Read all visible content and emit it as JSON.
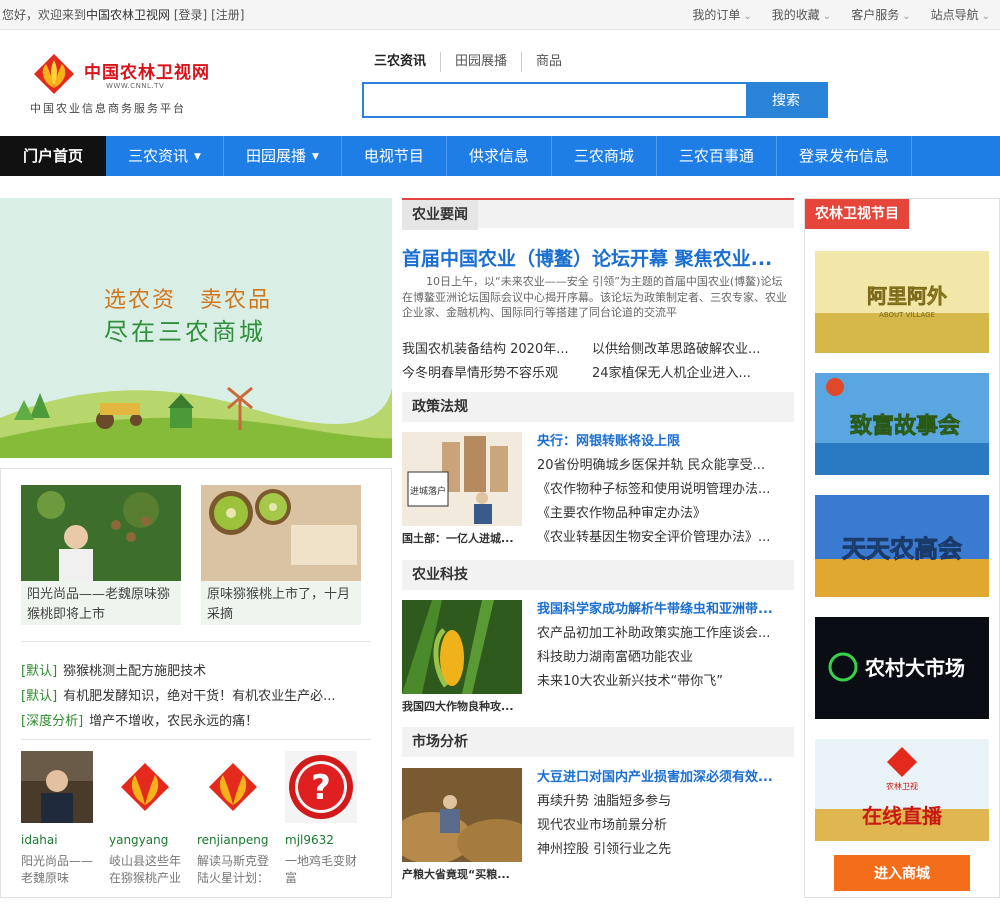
{
  "topbar": {
    "welcome": "您好，欢迎来到",
    "site_name": "中国农林卫视网",
    "login": "[登录]",
    "register": "[注册]",
    "links": [
      "我的订单",
      "我的收藏",
      "客户服务",
      "站点导航"
    ]
  },
  "logo": {
    "name_cn": "中国农林卫视网",
    "name_en": "WWW.CNNL.TV",
    "slogan": "中国农业信息商务服务平台"
  },
  "search": {
    "tabs": [
      "三农资讯",
      "田园展播",
      "商品"
    ],
    "button": "搜索",
    "placeholder": ""
  },
  "nav": {
    "items": [
      {
        "label": "门户首页"
      },
      {
        "label": "三农资讯",
        "dropdown": true
      },
      {
        "label": "田园展播",
        "dropdown": true
      },
      {
        "label": "电视节目"
      },
      {
        "label": "供求信息"
      },
      {
        "label": "三农商城"
      },
      {
        "label": "三农百事通"
      },
      {
        "label": "登录发布信息"
      }
    ]
  },
  "banner": {
    "line1": "选农资　卖农品",
    "line2": "尽在三农商城"
  },
  "left": {
    "cards": [
      {
        "caption": "阳光尚品——老魏原味猕猴桃即将上市"
      },
      {
        "caption": "原味猕猴桃上市了，十月采摘"
      }
    ],
    "list": [
      {
        "tag": "[默认]",
        "text": "猕猴桃测土配方施肥技术"
      },
      {
        "tag": "[默认]",
        "text": "有机肥发酵知识，绝对干货！有机农业生产必..."
      },
      {
        "tag": "[深度分析]",
        "text": "增产不增收，农民永远的痛！"
      }
    ],
    "users": [
      {
        "name": "idahai",
        "desc": "阳光尚品——老魏原味"
      },
      {
        "name": "yangyang",
        "desc": "岐山县这些年在猕猴桃产业"
      },
      {
        "name": "renjianpeng",
        "desc": "解读马斯克登陆火星计划："
      },
      {
        "name": "mjl9632",
        "desc": "一地鸡毛变财富"
      }
    ]
  },
  "news": {
    "label": "农业要闻",
    "headline": "首届中国农业（博鳌）论坛开幕 聚焦农业...",
    "summary": "10日上午，以“未来农业——安全 引领”为主题的首届中国农业(博鳌)论坛在博鳌亚洲论坛国际会议中心揭开序幕。该论坛为政策制定者、三农专家、农业企业家、金融机构、国际同行等搭建了同台论道的交流平",
    "items": [
      "我国农机装备结构 2020年...",
      "以供给侧改革思路破解农业...",
      "今冬明春旱情形势不容乐观",
      "24家植保无人机企业进入..."
    ]
  },
  "policy": {
    "label": "政策法规",
    "thumb_caption": "国土部：一亿人进城...",
    "thumb_text": "进城落户",
    "items": [
      "央行：网银转账将设上限",
      "20省份明确城乡医保并轨 民众能享受...",
      "《农作物种子标签和使用说明管理办法...",
      "《主要农作物品种审定办法》",
      "《农业转基因生物安全评价管理办法》..."
    ]
  },
  "tech": {
    "label": "农业科技",
    "thumb_caption": "我国四大作物良种攻...",
    "items": [
      "我国科学家成功解析牛带绦虫和亚洲带...",
      "农产品初加工补助政策实施工作座谈会...",
      "科技助力湖南富硒功能农业",
      "未来10大农业新兴技术“带你飞”"
    ]
  },
  "market": {
    "label": "市场分析",
    "thumb_caption": "产粮大省竟现“买粮...",
    "items": [
      "大豆进口对国内产业损害加深必须有效...",
      "再续升势 油脂短多参与",
      "现代农业市场前景分析",
      "神州控股 引领行业之先"
    ]
  },
  "programs": {
    "label": "农林卫视节目",
    "items": [
      "阿里阿外",
      "ABOUT VILLAGE",
      "致富故事会",
      "天天农高会",
      "农村大市场",
      "农林卫视",
      "在线直播"
    ],
    "mall_button": "进入商城"
  },
  "colors": {
    "primary_blue": "#1e7ee6",
    "accent_red": "#e6453a",
    "orange": "#f36d1b",
    "green": "#2f8f3a"
  }
}
